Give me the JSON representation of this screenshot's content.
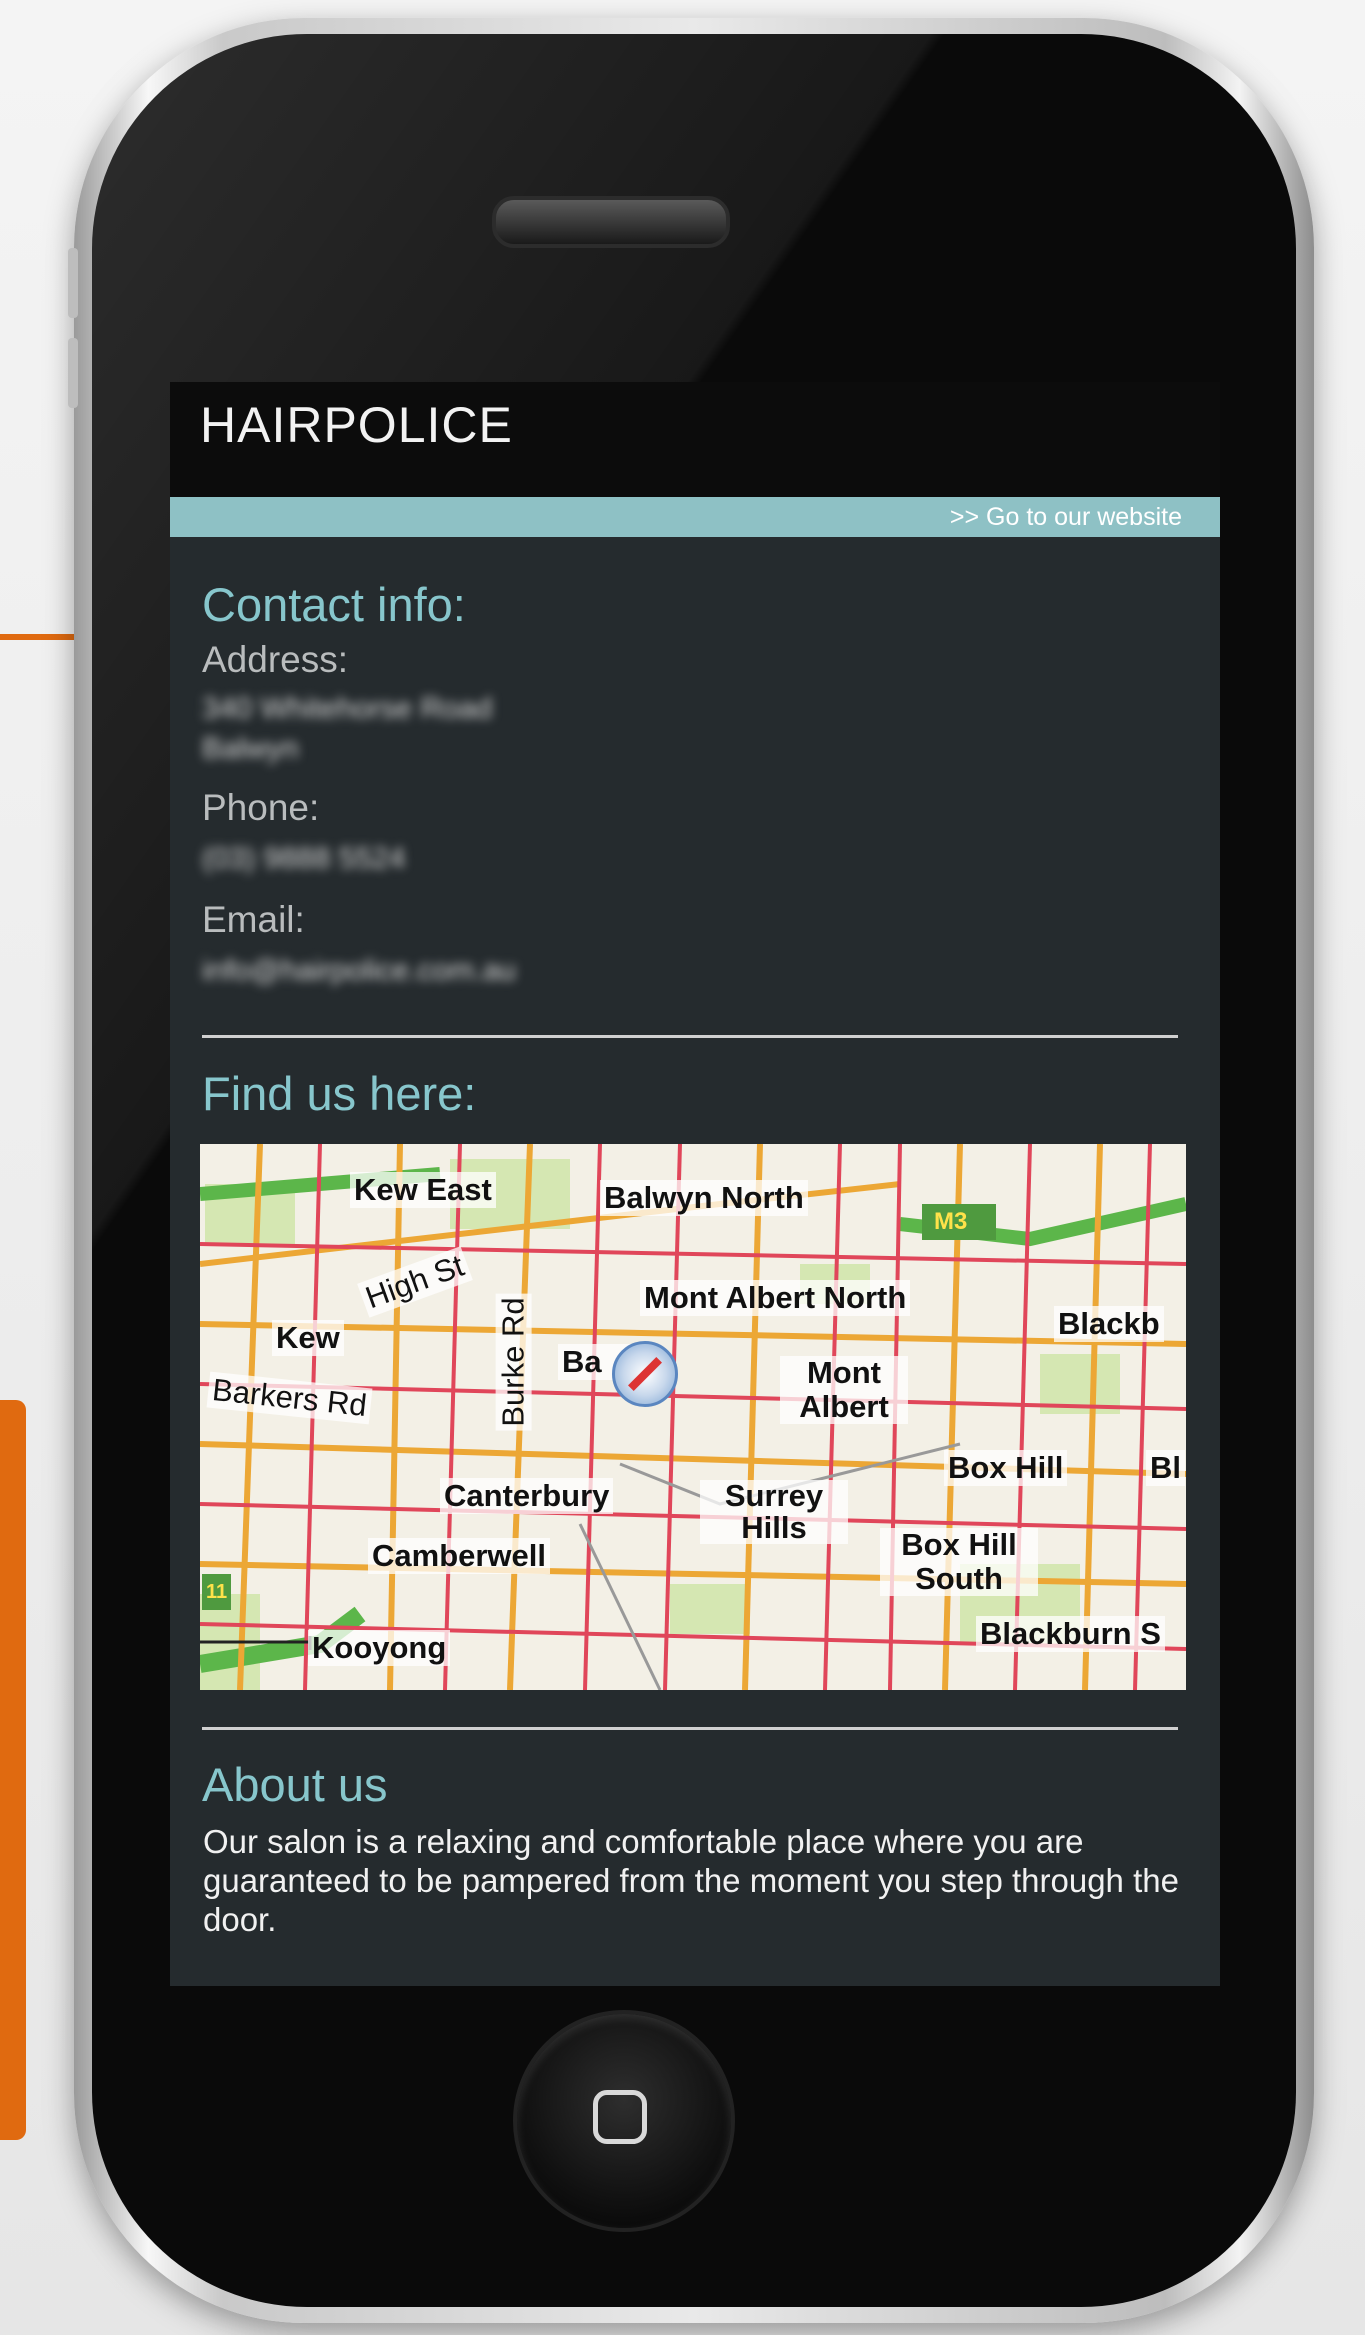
{
  "app": {
    "title": "HAIRPOLICE",
    "website_link": ">> Go to our website"
  },
  "contact": {
    "heading": "Contact info:",
    "address_label": "Address:",
    "address_line1": "340 Whitehorse Road",
    "address_line2": "Balwyn",
    "phone_label": "Phone:",
    "phone_value": "(03) 9888 5524",
    "email_label": "Email:",
    "email_value": "info@hairpolice.com.au"
  },
  "find_us": {
    "heading": "Find us here:",
    "map_labels": {
      "kew_east": "Kew East",
      "balwyn_north": "Balwyn North",
      "m3": "M3",
      "high_st": "High St",
      "mont_albert_north": "Mont Albert North",
      "blackburn": "Blackb",
      "kew": "Kew",
      "burke_rd": "Burke Rd",
      "balwyn": "Ba   n",
      "mont_albert": "Mont Albert",
      "barkers_rd": "Barkers Rd",
      "box_hill": "Box Hill",
      "bl": "Bl",
      "canterbury": "Canterbury",
      "surrey_hills": "Surrey Hills",
      "camberwell": "Camberwell",
      "box_hill_south": "Box Hill South",
      "kooyong": "Kooyong",
      "blackburn_s": "Blackburn S",
      "road_11": "11"
    }
  },
  "about": {
    "heading": "About us",
    "text": "Our salon is a relaxing and comfortable place where you are guaranteed to be pampered from the moment you step through the door."
  },
  "colors": {
    "accent": "#87c6cc",
    "link_bar": "#8ec1c5",
    "callout": "#e06a10",
    "screen_bg": "#252b2e"
  }
}
